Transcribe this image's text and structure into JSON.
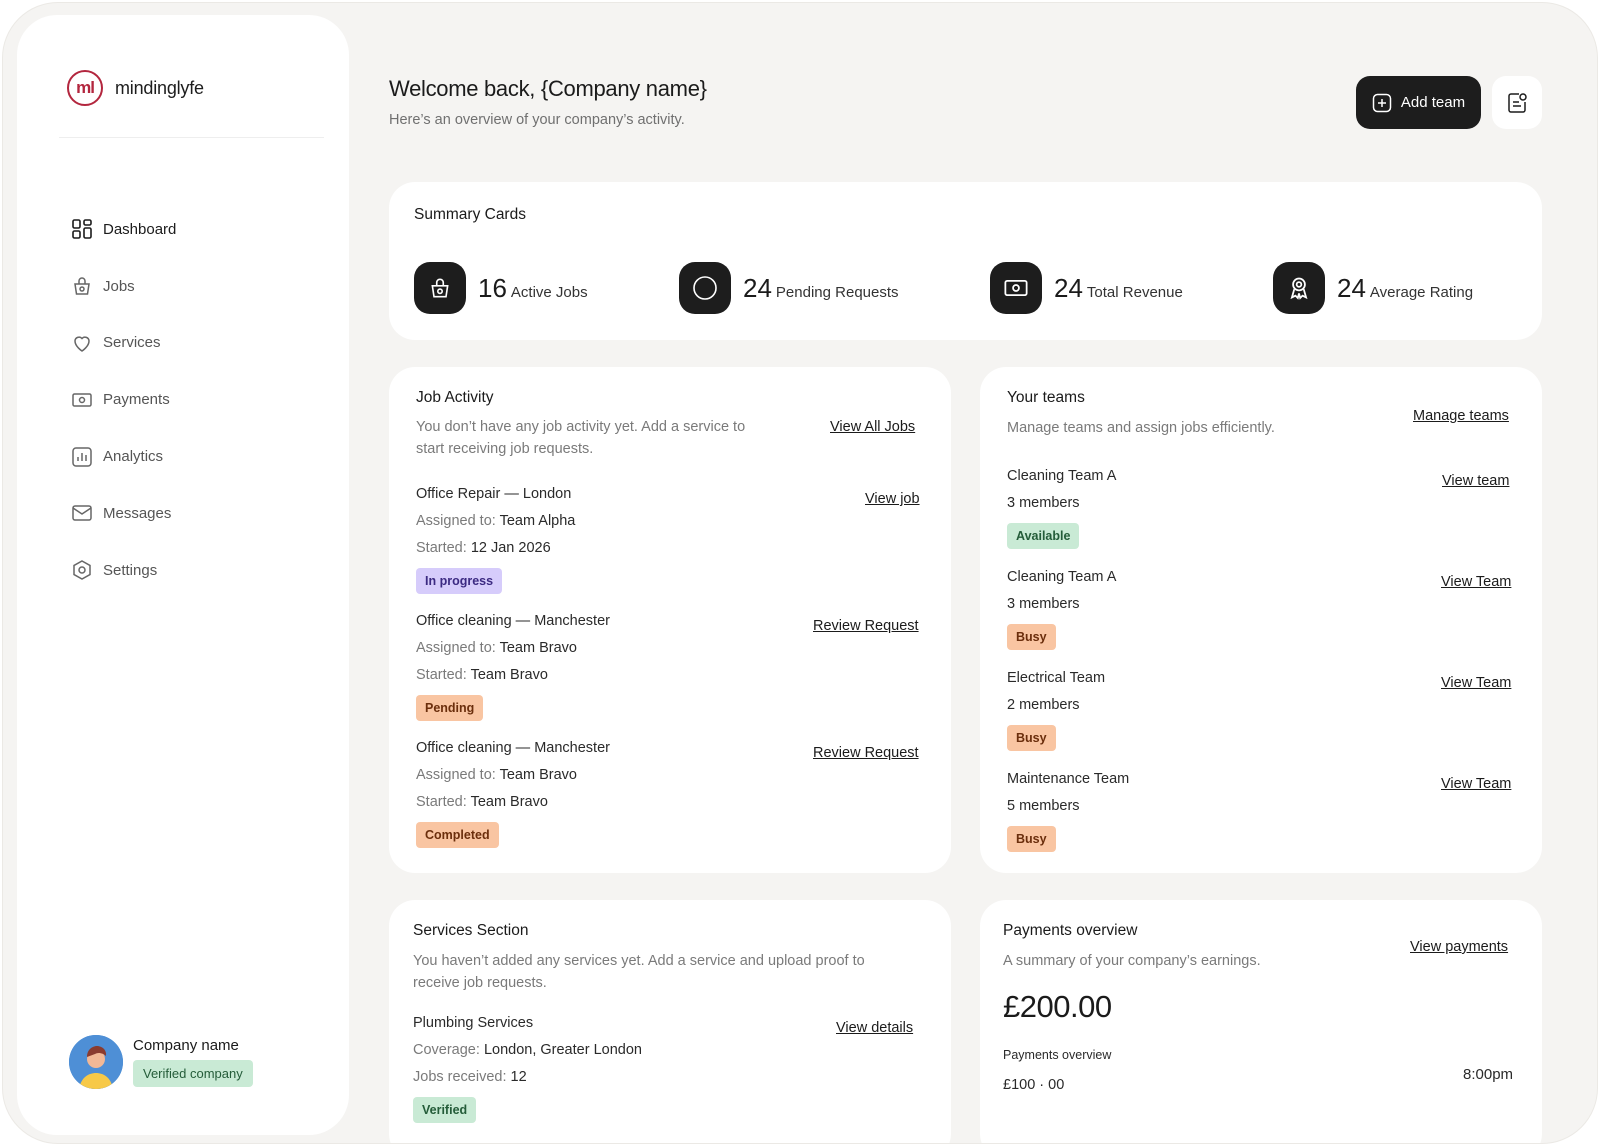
{
  "brand": {
    "name": "mindinglyfe",
    "mark": "ml"
  },
  "nav": [
    {
      "label": "Dashboard",
      "icon": "grid-icon"
    },
    {
      "label": "Jobs",
      "icon": "bag-icon"
    },
    {
      "label": "Services",
      "icon": "heart-icon"
    },
    {
      "label": "Payments",
      "icon": "money-icon"
    },
    {
      "label": "Analytics",
      "icon": "chart-icon"
    },
    {
      "label": "Messages",
      "icon": "mail-icon"
    },
    {
      "label": "Settings",
      "icon": "settings-icon"
    }
  ],
  "profile": {
    "name": "Company name",
    "badge": "Verified company"
  },
  "header": {
    "title": "Welcome back, {Company name}",
    "subtitle": "Here’s an overview of your company’s activity.",
    "add_team_label": "Add team"
  },
  "summary": {
    "title": "Summary Cards",
    "stats": [
      {
        "value": "16",
        "label": "Active Jobs",
        "icon": "bag-icon"
      },
      {
        "value": "24",
        "label": "Pending Requests",
        "icon": "circle-icon"
      },
      {
        "value": "24",
        "label": "Total Revenue",
        "icon": "money-icon"
      },
      {
        "value": "24",
        "label": "Average Rating",
        "icon": "award-icon"
      }
    ]
  },
  "job_activity": {
    "title": "Job Activity",
    "description": "You don’t have any job activity yet. Add a service to start receiving job requests.",
    "view_all_label": "View All Jobs",
    "jobs": [
      {
        "title": "Office Repair — London",
        "assigned_key": "Assigned to:",
        "assigned": "Team Alpha",
        "started_key": "Started:",
        "started": "12 Jan 2026",
        "status": "In progress",
        "action": "View job"
      },
      {
        "title": "Office cleaning — Manchester",
        "assigned_key": "Assigned to:",
        "assigned": "Team Bravo",
        "started_key": "Started:",
        "started": "Team Bravo",
        "status": "Pending",
        "action": "Review Request"
      },
      {
        "title": "Office cleaning — Manchester",
        "assigned_key": "Assigned to:",
        "assigned": "Team Bravo",
        "started_key": "Started:",
        "started": "Team Bravo",
        "status": "Completed",
        "action": "Review Request"
      }
    ]
  },
  "teams": {
    "title": "Your teams",
    "description": "Manage teams and assign jobs efficiently.",
    "manage_label": "Manage teams",
    "items": [
      {
        "name": "Cleaning Team A",
        "members": "3 members",
        "status": "Available",
        "action": "View team"
      },
      {
        "name": "Cleaning Team A",
        "members": "3 members",
        "status": "Busy",
        "action": "View Team"
      },
      {
        "name": "Electrical Team",
        "members": "2 members",
        "status": "Busy",
        "action": "View Team"
      },
      {
        "name": "Maintenance Team",
        "members": "5 members",
        "status": "Busy",
        "action": "View Team"
      }
    ]
  },
  "services": {
    "title": "Services Section",
    "description": "You haven’t added any services yet. Add a service and upload proof to receive job requests.",
    "item": {
      "title": "Plumbing Services",
      "coverage_key": "Coverage:",
      "coverage": "London, Greater London",
      "jobs_key": "Jobs received:",
      "jobs": "12",
      "status": "Verified",
      "action": "View details"
    }
  },
  "payments": {
    "title": "Payments overview",
    "description": "A summary of your company’s earnings.",
    "view_label": "View payments",
    "total": "£200.00",
    "sub_title": "Payments overview",
    "amount": "£100 · 00",
    "time": "8:00pm"
  },
  "colors": {
    "accent_dark": "#1d1d1d",
    "brand_red": "#b3263e",
    "status_purple": "#d6ccfb",
    "status_orange": "#f9c5a2",
    "status_green": "#c9ead5"
  }
}
